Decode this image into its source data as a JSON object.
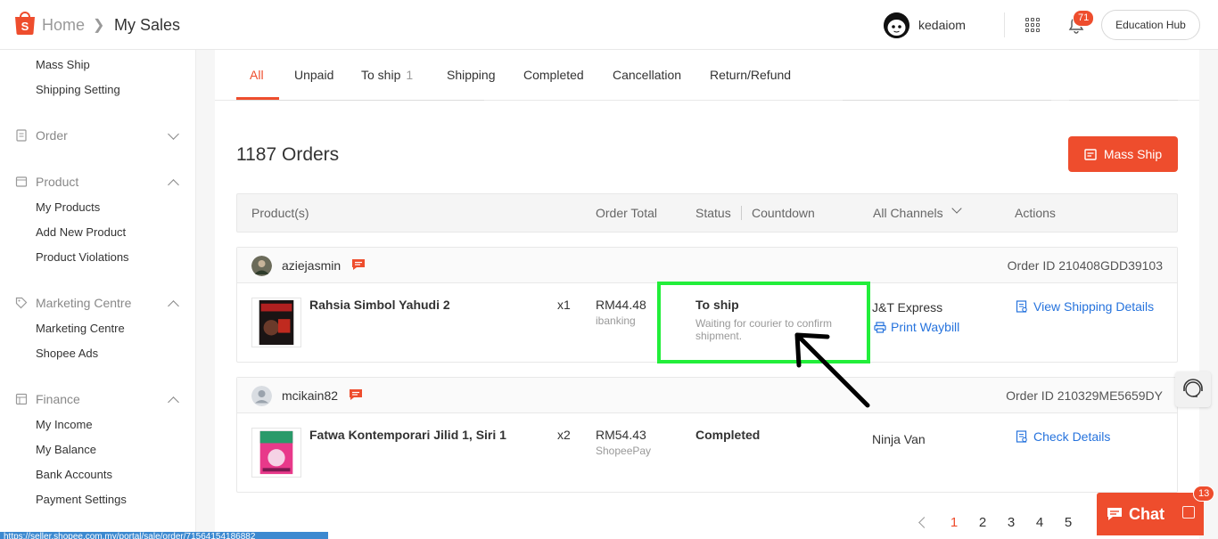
{
  "header": {
    "breadcrumb_home": "Home",
    "breadcrumb_current": "My Sales",
    "user_name": "kedaiom",
    "notification_count": "71",
    "education_hub_label": "Education Hub"
  },
  "sidebar": {
    "shipment_items": [
      "Mass Ship",
      "Shipping Setting"
    ],
    "sections": [
      {
        "title": "Order",
        "expanded": false,
        "items": []
      },
      {
        "title": "Product",
        "expanded": true,
        "items": [
          "My Products",
          "Add New Product",
          "Product Violations"
        ]
      },
      {
        "title": "Marketing Centre",
        "expanded": true,
        "items": [
          "Marketing Centre",
          "Shopee Ads"
        ]
      },
      {
        "title": "Finance",
        "expanded": true,
        "items": [
          "My Income",
          "My Balance",
          "Bank Accounts",
          "Payment Settings"
        ]
      }
    ]
  },
  "tabs": [
    {
      "label": "All",
      "active": true
    },
    {
      "label": "Unpaid"
    },
    {
      "label": "To ship",
      "count": "1"
    },
    {
      "label": "Shipping"
    },
    {
      "label": "Completed"
    },
    {
      "label": "Cancellation"
    },
    {
      "label": "Return/Refund"
    }
  ],
  "orders_title": "1187 Orders",
  "mass_ship_label": "Mass Ship",
  "table_headers": {
    "products": "Product(s)",
    "order_total": "Order Total",
    "status": "Status",
    "countdown": "Countdown",
    "channels": "All Channels",
    "actions": "Actions"
  },
  "orders": [
    {
      "buyer": "aziejasmin",
      "order_id": "Order ID 210408GDD39103",
      "product": "Rahsia Simbol Yahudi 2",
      "qty": "x1",
      "total": "RM44.48",
      "payment": "ibanking",
      "status": "To ship",
      "status_note": "Waiting for courier to confirm shipment.",
      "courier": "J&T Express",
      "secondary_action": "Print Waybill",
      "action": "View Shipping Details"
    },
    {
      "buyer": "mcikain82",
      "order_id": "Order ID 210329ME5659DY",
      "product": "Fatwa Kontemporari Jilid 1, Siri 1",
      "qty": "x2",
      "total": "RM54.43",
      "payment": "ShopeePay",
      "status": "Completed",
      "courier": "Ninja Van",
      "action": "Check Details"
    }
  ],
  "pagination": {
    "pages": [
      "1",
      "2",
      "3",
      "4",
      "5"
    ],
    "current": "1"
  },
  "chat": {
    "label": "Chat",
    "badge": "13"
  },
  "status_url": "https://seller.shopee.com.my/portal/sale/order/71564154186882",
  "colors": {
    "accent": "#ee4d2d",
    "link": "#2673dd",
    "highlight": "#22ee3a"
  }
}
